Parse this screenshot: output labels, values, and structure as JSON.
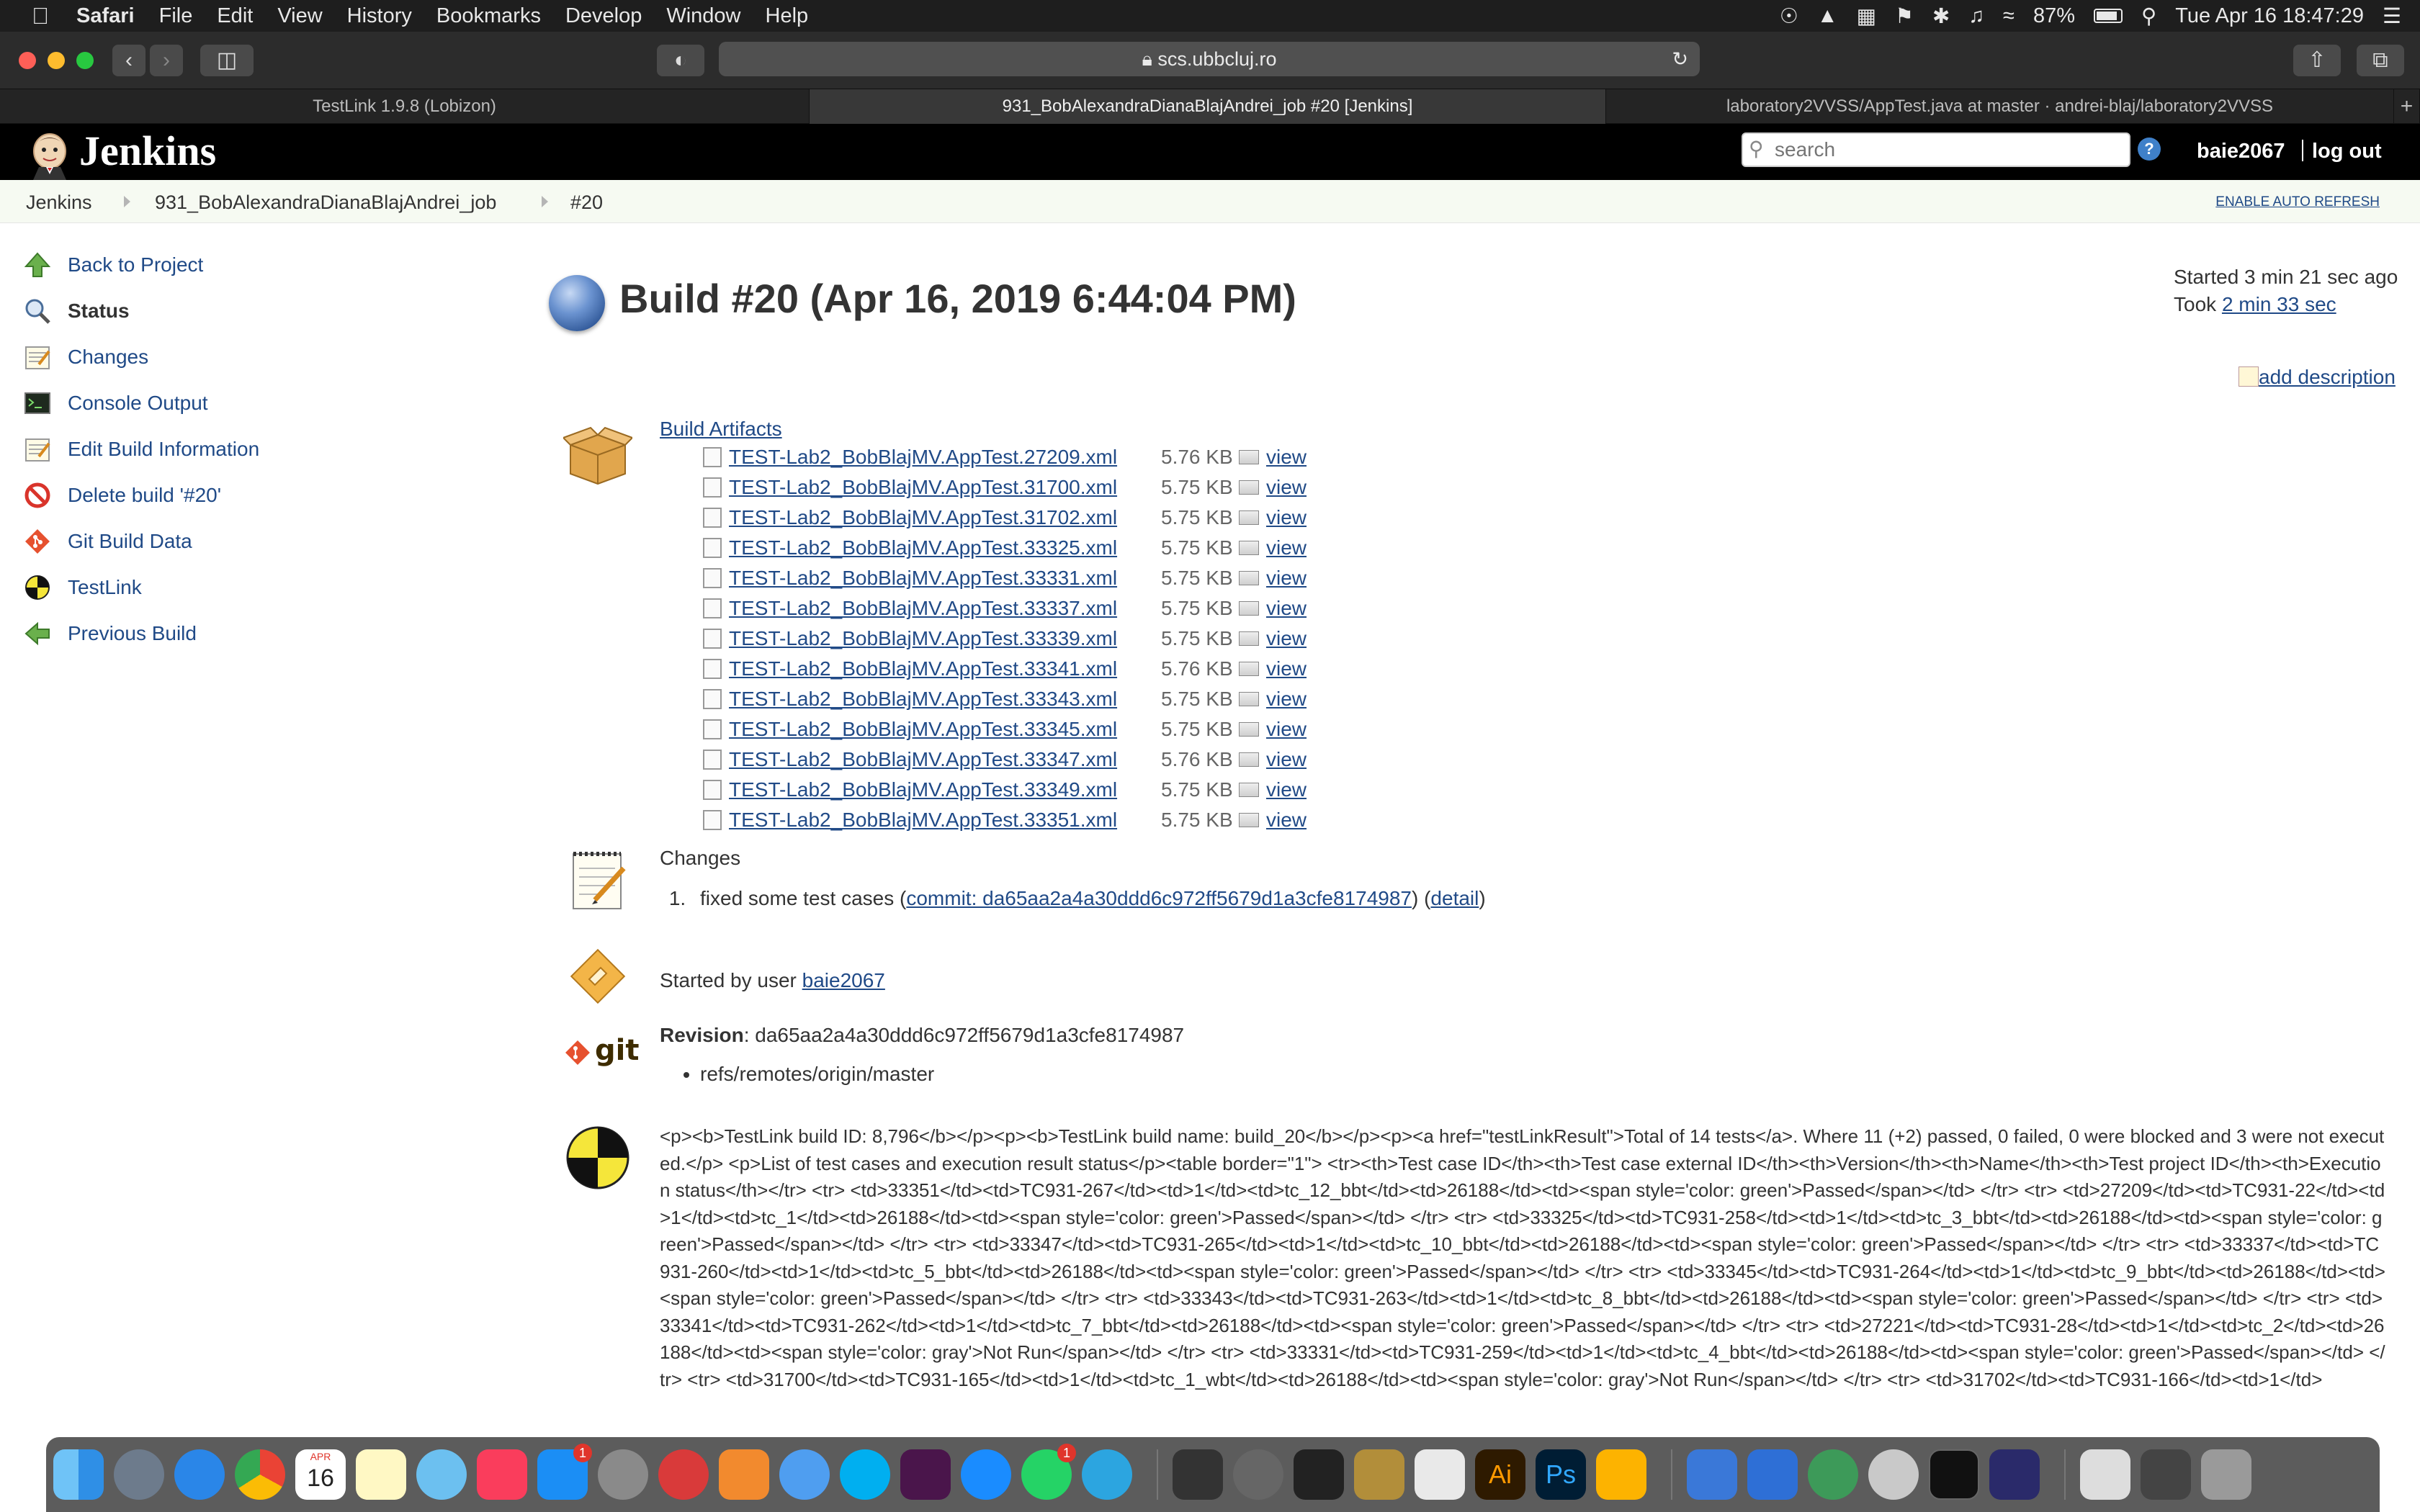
{
  "menubar": {
    "app": "Safari",
    "items": [
      "File",
      "Edit",
      "View",
      "History",
      "Bookmarks",
      "Develop",
      "Window",
      "Help"
    ],
    "battery": "87%",
    "datetime": "Tue Apr 16  18:47:29"
  },
  "browser": {
    "url": "scs.ubbcluj.ro",
    "tabs": [
      {
        "title": "TestLink 1.9.8 (Lobizon)",
        "active": false
      },
      {
        "title": "931_BobAlexandraDianaBlajAndrei_job #20 [Jenkins]",
        "active": true
      },
      {
        "title": "laboratory2VVSS/AppTest.java at master · andrei-blaj/laboratory2VVSS",
        "active": false
      }
    ],
    "new_tab": "+"
  },
  "header": {
    "logo": "Jenkins",
    "search_placeholder": "search",
    "help": "?",
    "user": "baie2067",
    "logout": "log out"
  },
  "breadcrumbs": {
    "items": [
      "Jenkins",
      "931_BobAlexandraDianaBlajAndrei_job",
      "#20"
    ],
    "auto_refresh": "ENABLE AUTO REFRESH"
  },
  "sidebar": {
    "items": [
      {
        "label": "Back to Project",
        "icon": "up-arrow-icon"
      },
      {
        "label": "Status",
        "icon": "magnifier-icon"
      },
      {
        "label": "Changes",
        "icon": "notepad-icon"
      },
      {
        "label": "Console Output",
        "icon": "terminal-icon"
      },
      {
        "label": "Edit Build Information",
        "icon": "notepad-icon"
      },
      {
        "label": "Delete build '#20'",
        "icon": "no-entry-icon"
      },
      {
        "label": "Git Build Data",
        "icon": "git-icon"
      },
      {
        "label": "TestLink",
        "icon": "testlink-icon"
      },
      {
        "label": "Previous Build",
        "icon": "left-arrow-icon"
      }
    ]
  },
  "build": {
    "title": "Build #20 (Apr 16, 2019 6:44:04 PM)",
    "started": "Started 3 min 21 sec ago",
    "took_prefix": "Took ",
    "took_link": "2 min 33 sec",
    "add_description": "add description"
  },
  "artifacts": {
    "title": "Build Artifacts",
    "view_label": "view",
    "files": [
      {
        "name": "TEST-Lab2_BobBlajMV.AppTest.27209.xml",
        "size": "5.76 KB"
      },
      {
        "name": "TEST-Lab2_BobBlajMV.AppTest.31700.xml",
        "size": "5.75 KB"
      },
      {
        "name": "TEST-Lab2_BobBlajMV.AppTest.31702.xml",
        "size": "5.75 KB"
      },
      {
        "name": "TEST-Lab2_BobBlajMV.AppTest.33325.xml",
        "size": "5.75 KB"
      },
      {
        "name": "TEST-Lab2_BobBlajMV.AppTest.33331.xml",
        "size": "5.75 KB"
      },
      {
        "name": "TEST-Lab2_BobBlajMV.AppTest.33337.xml",
        "size": "5.75 KB"
      },
      {
        "name": "TEST-Lab2_BobBlajMV.AppTest.33339.xml",
        "size": "5.75 KB"
      },
      {
        "name": "TEST-Lab2_BobBlajMV.AppTest.33341.xml",
        "size": "5.76 KB"
      },
      {
        "name": "TEST-Lab2_BobBlajMV.AppTest.33343.xml",
        "size": "5.75 KB"
      },
      {
        "name": "TEST-Lab2_BobBlajMV.AppTest.33345.xml",
        "size": "5.75 KB"
      },
      {
        "name": "TEST-Lab2_BobBlajMV.AppTest.33347.xml",
        "size": "5.76 KB"
      },
      {
        "name": "TEST-Lab2_BobBlajMV.AppTest.33349.xml",
        "size": "5.75 KB"
      },
      {
        "name": "TEST-Lab2_BobBlajMV.AppTest.33351.xml",
        "size": "5.75 KB"
      }
    ]
  },
  "changes": {
    "title": "Changes",
    "entries": [
      {
        "text": "fixed some test cases (",
        "commit": "commit: da65aa2a4a30ddd6c972ff5679d1a3cfe8174987",
        "mid": ") (",
        "detail": "detail",
        "end": ")"
      }
    ]
  },
  "cause": {
    "prefix": "Started by user ",
    "user": "baie2067"
  },
  "git": {
    "revision_label": "Revision",
    "revision_value": ": da65aa2a4a30ddd6c972ff5679d1a3cfe8174987",
    "branch": "refs/remotes/origin/master"
  },
  "testlink": {
    "raw": "<p><b>TestLink build ID: 8,796</b></p><p><b>TestLink build name: build_20</b></p><p><a href=\"testLinkResult\">Total of 14 tests</a>. Where 11 (+2) passed, 0 failed, 0 were blocked and 3 were not executed.</p> <p>List of test cases and execution result status</p><table border=\"1\"> <tr><th>Test case ID</th><th>Test case external ID</th><th>Version</th><th>Name</th><th>Test project ID</th><th>Execution status</th></tr> <tr> <td>33351</td><td>TC931-267</td><td>1</td><td>tc_12_bbt</td><td>26188</td><td><span style='color: green'>Passed</span></td> </tr> <tr> <td>27209</td><td>TC931-22</td><td>1</td><td>tc_1</td><td>26188</td><td><span style='color: green'>Passed</span></td> </tr> <tr> <td>33325</td><td>TC931-258</td><td>1</td><td>tc_3_bbt</td><td>26188</td><td><span style='color: green'>Passed</span></td> </tr> <tr> <td>33347</td><td>TC931-265</td><td>1</td><td>tc_10_bbt</td><td>26188</td><td><span style='color: green'>Passed</span></td> </tr> <tr> <td>33337</td><td>TC931-260</td><td>1</td><td>tc_5_bbt</td><td>26188</td><td><span style='color: green'>Passed</span></td> </tr> <tr> <td>33345</td><td>TC931-264</td><td>1</td><td>tc_9_bbt</td><td>26188</td><td><span style='color: green'>Passed</span></td> </tr> <tr> <td>33343</td><td>TC931-263</td><td>1</td><td>tc_8_bbt</td><td>26188</td><td><span style='color: green'>Passed</span></td> </tr> <tr> <td>33341</td><td>TC931-262</td><td>1</td><td>tc_7_bbt</td><td>26188</td><td><span style='color: green'>Passed</span></td> </tr> <tr> <td>27221</td><td>TC931-28</td><td>1</td><td>tc_2</td><td>26188</td><td><span style='color: gray'>Not Run</span></td> </tr> <tr> <td>33331</td><td>TC931-259</td><td>1</td><td>tc_4_bbt</td><td>26188</td><td><span style='color: green'>Passed</span></td> </tr> <tr> <td>31700</td><td>TC931-165</td><td>1</td><td>tc_1_wbt</td><td>26188</td><td><span style='color: gray'>Not Run</span></td> </tr> <tr> <td>31702</td><td>TC931-166</td><td>1</td>"
  },
  "dock": {
    "badges": {
      "appstore": "1",
      "whatsapp": "1"
    },
    "calendar": {
      "month": "APR",
      "day": "16"
    }
  },
  "colors": {
    "link": "#204a87",
    "jenkins_header": "#000000",
    "build_orb": "#4a78c0"
  }
}
